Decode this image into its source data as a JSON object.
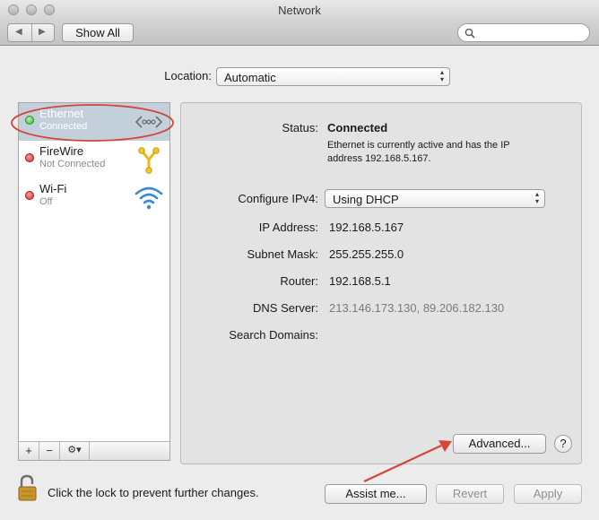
{
  "window": {
    "title": "Network"
  },
  "toolbar": {
    "back": "◀",
    "forward": "▶",
    "show_all": "Show All",
    "search_placeholder": ""
  },
  "location": {
    "label": "Location:",
    "value": "Automatic"
  },
  "services": [
    {
      "name": "Ethernet",
      "status": "Connected",
      "state_color": "#2fbf2f",
      "icon": "ethernet-icon",
      "selected": true
    },
    {
      "name": "FireWire",
      "status": "Not Connected",
      "state_color": "#d63232",
      "icon": "firewire-icon",
      "selected": false
    },
    {
      "name": "Wi-Fi",
      "status": "Off",
      "state_color": "#d63232",
      "icon": "wifi-icon",
      "selected": false
    }
  ],
  "sidebar_buttons": {
    "add": "+",
    "remove": "−",
    "gear": "⚙▾"
  },
  "details": {
    "status_label": "Status:",
    "status_value": "Connected",
    "status_desc_1": "Ethernet is currently active and has the IP",
    "status_desc_2": "address 192.168.5.167.",
    "configure_label": "Configure IPv4:",
    "configure_value": "Using DHCP",
    "ip_label": "IP Address:",
    "ip_value": "192.168.5.167",
    "subnet_label": "Subnet Mask:",
    "subnet_value": "255.255.255.0",
    "router_label": "Router:",
    "router_value": "192.168.5.1",
    "dns_label": "DNS Server:",
    "dns_value": "213.146.173.130, 89.206.182.130",
    "search_domains_label": "Search Domains:",
    "advanced": "Advanced...",
    "help": "?"
  },
  "footer": {
    "lock_text": "Click the lock to prevent further changes.",
    "assist": "Assist me...",
    "revert": "Revert",
    "apply": "Apply"
  },
  "colors": {
    "annotation": "#d2463c",
    "selection": "#c4cfdc"
  }
}
